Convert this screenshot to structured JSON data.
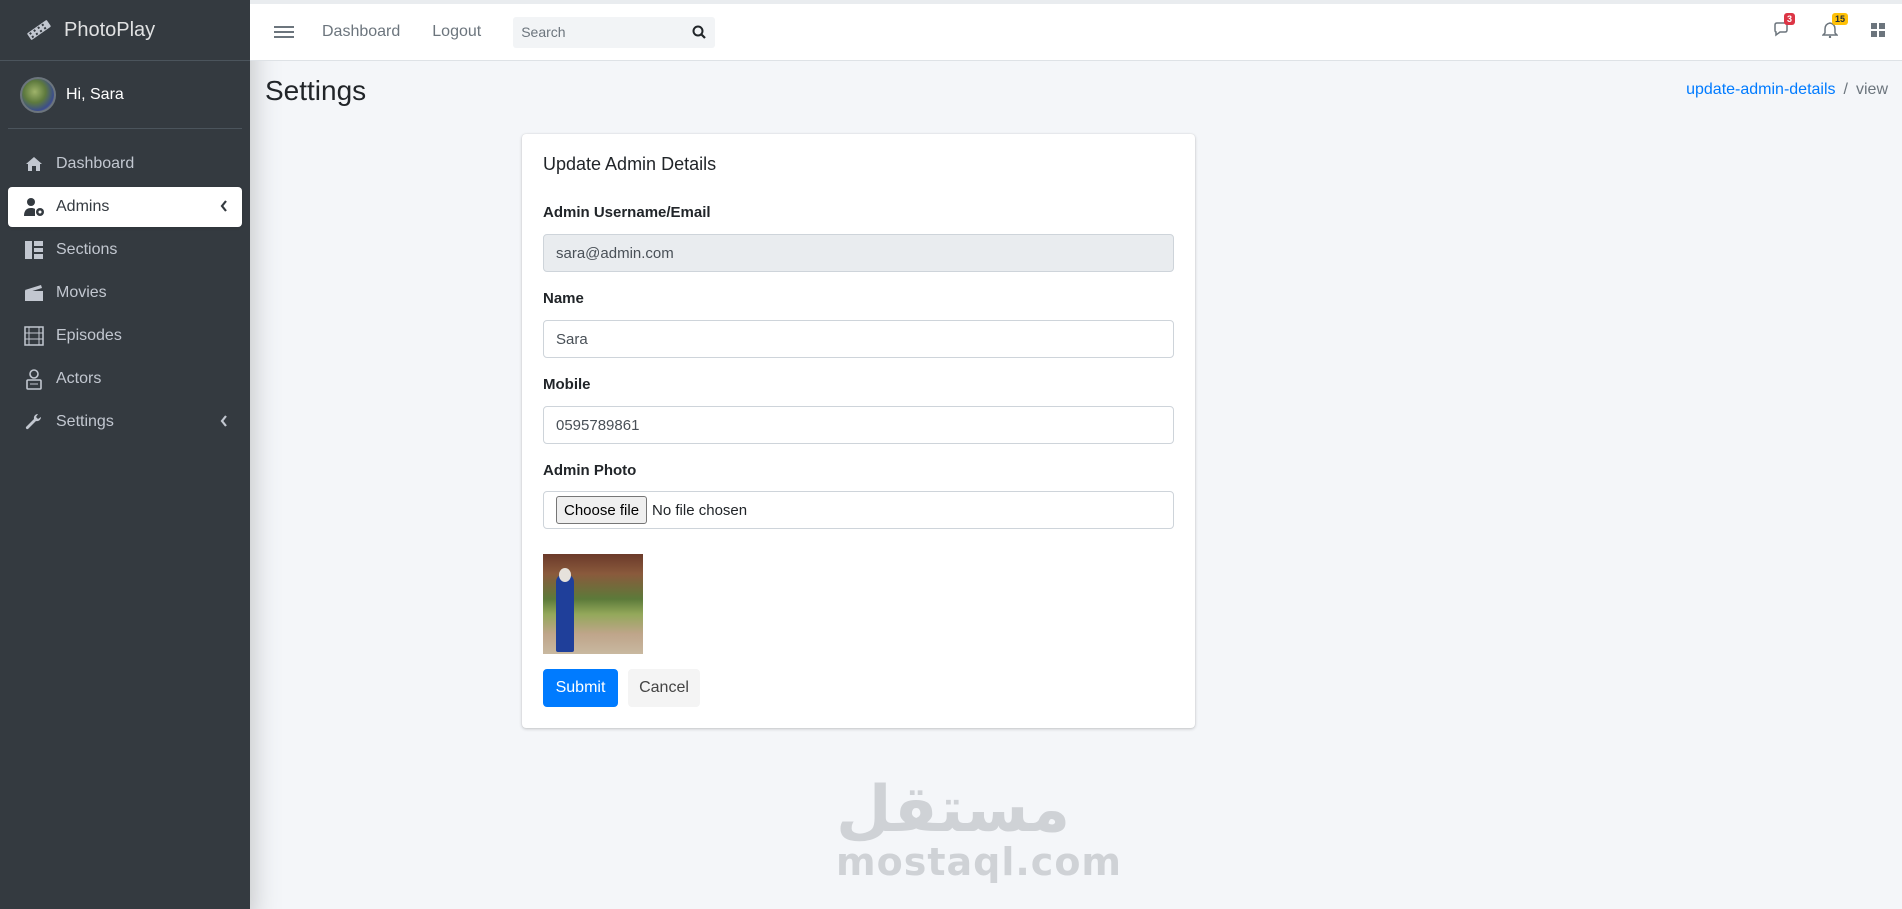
{
  "brand": {
    "name": "PhotoPlay"
  },
  "user": {
    "greeting": "Hi, Sara"
  },
  "sidebar": {
    "items": [
      {
        "label": "Dashboard",
        "icon": "home-icon"
      },
      {
        "label": "Admins",
        "icon": "user-cog-icon",
        "active": true
      },
      {
        "label": "Sections",
        "icon": "columns-icon"
      },
      {
        "label": "Movies",
        "icon": "clapperboard-icon"
      },
      {
        "label": "Episodes",
        "icon": "film-strip-icon"
      },
      {
        "label": "Actors",
        "icon": "actor-icon"
      },
      {
        "label": "Settings",
        "icon": "wrench-icon"
      }
    ]
  },
  "topbar": {
    "links": [
      "Dashboard",
      "Logout"
    ],
    "search_placeholder": "Search",
    "messages_count": "3",
    "notifications_count": "15"
  },
  "page": {
    "title": "Settings",
    "breadcrumb": {
      "link": "update-admin-details",
      "sep": "/",
      "current": "view"
    }
  },
  "card": {
    "title": "Update Admin Details",
    "fields": {
      "email_label": "Admin Username/Email",
      "email_value": "sara@admin.com",
      "name_label": "Name",
      "name_value": "Sara",
      "mobile_label": "Mobile",
      "mobile_value": "0595789861",
      "photo_label": "Admin Photo",
      "file_button": "Choose file",
      "file_status": "No file chosen"
    },
    "submit_label": "Submit",
    "cancel_label": "Cancel"
  },
  "watermark": {
    "arabic": "مستقل",
    "latin": "mostaql.com"
  },
  "colors": {
    "sidebar_bg": "#343a40",
    "primary": "#007bff",
    "badge_red": "#dc3545",
    "badge_yellow": "#ffc107"
  }
}
